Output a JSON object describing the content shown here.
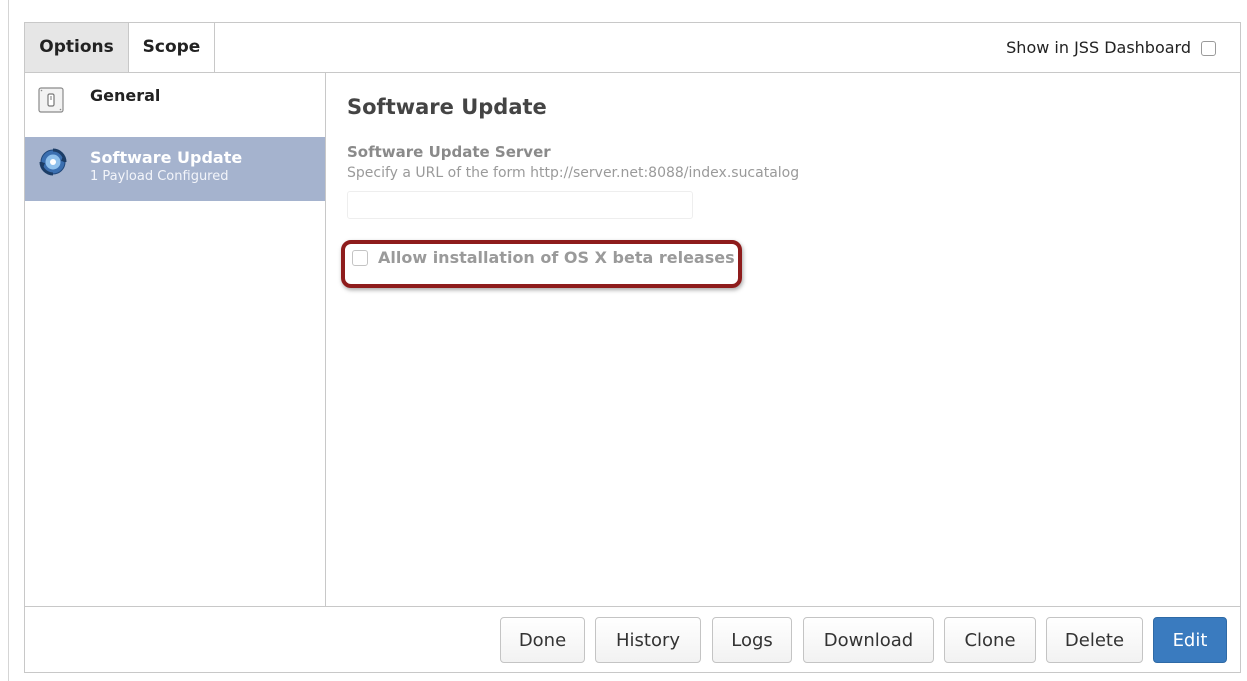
{
  "tabs": [
    {
      "label": "Options",
      "active": true
    },
    {
      "label": "Scope",
      "active": false
    }
  ],
  "dashboard_toggle": {
    "label": "Show in JSS Dashboard",
    "checked": false
  },
  "sidebar": {
    "items": [
      {
        "title": "General",
        "subtitle": "",
        "icon": "switch-icon",
        "selected": false
      },
      {
        "title": "Software Update",
        "subtitle": "1 Payload Configured",
        "icon": "software-update-icon",
        "selected": true
      }
    ],
    "selected_color": "#a5b3ce"
  },
  "content": {
    "title": "Software Update",
    "server_field": {
      "label": "Software Update Server",
      "help": "Specify a URL of the form http://server.net:8088/index.sucatalog",
      "value": ""
    },
    "beta_option": {
      "label": "Allow installation of OS X beta releases",
      "checked": false
    },
    "highlight_color": "#8e1c1c"
  },
  "footer": {
    "buttons": [
      "Done",
      "History",
      "Logs",
      "Download",
      "Clone",
      "Delete",
      "Edit"
    ],
    "primary_color": "#3a7bbf"
  }
}
